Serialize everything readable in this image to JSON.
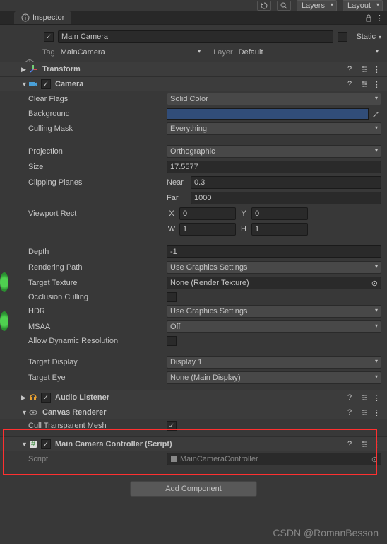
{
  "topbar": {
    "layers_label": "Layers",
    "layout_label": "Layout"
  },
  "tab": {
    "title": "Inspector"
  },
  "gameObject": {
    "name": "Main Camera",
    "static_label": "Static",
    "tag_label": "Tag",
    "tag_value": "MainCamera",
    "layer_label": "Layer",
    "layer_value": "Default"
  },
  "components": {
    "transform": {
      "title": "Transform"
    },
    "camera": {
      "title": "Camera",
      "clear_flags_label": "Clear Flags",
      "clear_flags_value": "Solid Color",
      "background_label": "Background",
      "culling_mask_label": "Culling Mask",
      "culling_mask_value": "Everything",
      "projection_label": "Projection",
      "projection_value": "Orthographic",
      "size_label": "Size",
      "size_value": "17.5577",
      "clipping_label": "Clipping Planes",
      "near_label": "Near",
      "near_value": "0.3",
      "far_label": "Far",
      "far_value": "1000",
      "viewport_label": "Viewport Rect",
      "x_label": "X",
      "x_value": "0",
      "y_label": "Y",
      "y_value": "0",
      "w_label": "W",
      "w_value": "1",
      "h_label": "H",
      "h_value": "1",
      "depth_label": "Depth",
      "depth_value": "-1",
      "rendering_path_label": "Rendering Path",
      "rendering_path_value": "Use Graphics Settings",
      "target_texture_label": "Target Texture",
      "target_texture_value": "None (Render Texture)",
      "occlusion_label": "Occlusion Culling",
      "hdr_label": "HDR",
      "hdr_value": "Use Graphics Settings",
      "msaa_label": "MSAA",
      "msaa_value": "Off",
      "dynamic_res_label": "Allow Dynamic Resolution",
      "target_display_label": "Target Display",
      "target_display_value": "Display 1",
      "target_eye_label": "Target Eye",
      "target_eye_value": "None (Main Display)"
    },
    "audio": {
      "title": "Audio Listener"
    },
    "canvas": {
      "title": "Canvas Renderer",
      "cull_label": "Cull Transparent Mesh"
    },
    "script": {
      "title": "Main Camera Controller (Script)",
      "script_label": "Script",
      "script_value": "MainCameraController"
    }
  },
  "add_component_label": "Add Component",
  "watermark": "CSDN @RomanBesson"
}
